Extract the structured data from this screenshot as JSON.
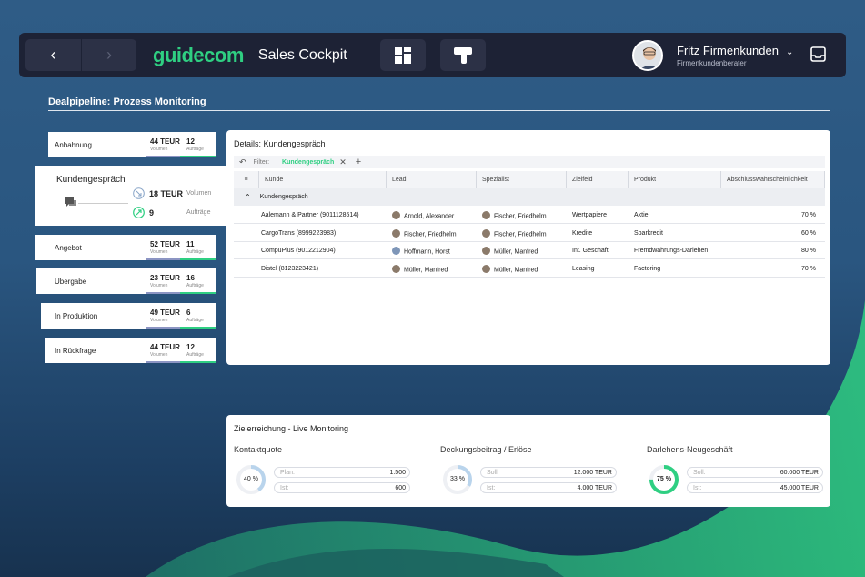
{
  "header": {
    "logo": "guidecom",
    "app_title": "Sales Cockpit",
    "user_name": "Fritz Firmenkunden",
    "user_role": "Firmenkundenberater"
  },
  "pipeline": {
    "title": "Dealpipeline: Prozess Monitoring",
    "volume_label": "Volumen",
    "count_label": "Aufträge",
    "stages": [
      {
        "label": "Anbahnung",
        "volume": "44 TEUR",
        "count": "12"
      },
      {
        "label": "Kundengespräch",
        "volume": "18 TEUR",
        "count": "9"
      },
      {
        "label": "Angebot",
        "volume": "52 TEUR",
        "count": "11"
      },
      {
        "label": "Übergabe",
        "volume": "23 TEUR",
        "count": "16"
      },
      {
        "label": "In Produktion",
        "volume": "49 TEUR",
        "count": "6"
      },
      {
        "label": "In Rückfrage",
        "volume": "44 TEUR",
        "count": "12"
      }
    ]
  },
  "details": {
    "title": "Details: Kundengespräch",
    "filter_label": "Filter:",
    "filter_value": "Kundengespräch",
    "columns": [
      "Kunde",
      "Lead",
      "Spezialist",
      "Zielfeld",
      "Produkt",
      "Abschlusswahrscheinlichkeit"
    ],
    "group_label": "Kundengespräch",
    "rows": [
      {
        "kunde": "Aalemann & Partner (9011128514)",
        "lead": "Arnold, Alexander",
        "spezialist": "Fischer, Friedhelm",
        "zielfeld": "Wertpapiere",
        "produkt": "Aktie",
        "prob": "70 %"
      },
      {
        "kunde": "CargoTrans (8999223983)",
        "lead": "Fischer, Friedhelm",
        "spezialist": "Fischer, Friedhelm",
        "zielfeld": "Kredite",
        "produkt": "Sparkredit",
        "prob": "60 %"
      },
      {
        "kunde": "CompuPlus (9012212904)",
        "lead": "Hoffmann, Horst",
        "spezialist": "Müller, Manfred",
        "zielfeld": "Int. Geschäft",
        "produkt": "Fremdwährungs-Darlehen",
        "prob": "80 %"
      },
      {
        "kunde": "Distel (8123223421)",
        "lead": "Müller, Manfred",
        "spezialist": "Müller, Manfred",
        "zielfeld": "Leasing",
        "produkt": "Factoring",
        "prob": "70 %"
      }
    ]
  },
  "monitoring": {
    "title": "Zielerreichung - Live Monitoring",
    "kpis": [
      {
        "title": "Kontaktquote",
        "percent": "40 %",
        "fraction": 0.4,
        "color": "#b9d4ec",
        "k1": "Plan:",
        "v1": "1.500",
        "k2": "Ist:",
        "v2": "600"
      },
      {
        "title": "Deckungsbeitrag / Erlöse",
        "percent": "33 %",
        "fraction": 0.33,
        "color": "#b9d4ec",
        "k1": "Soll:",
        "v1": "12.000 TEUR",
        "k2": "Ist:",
        "v2": "4.000 TEUR"
      },
      {
        "title": "Darlehens-Neugeschäft",
        "percent": "75 %",
        "fraction": 0.75,
        "color": "#2fcf82",
        "k1": "Soll:",
        "v1": "60.000 TEUR",
        "k2": "Ist:",
        "v2": "45.000 TEUR"
      }
    ]
  }
}
